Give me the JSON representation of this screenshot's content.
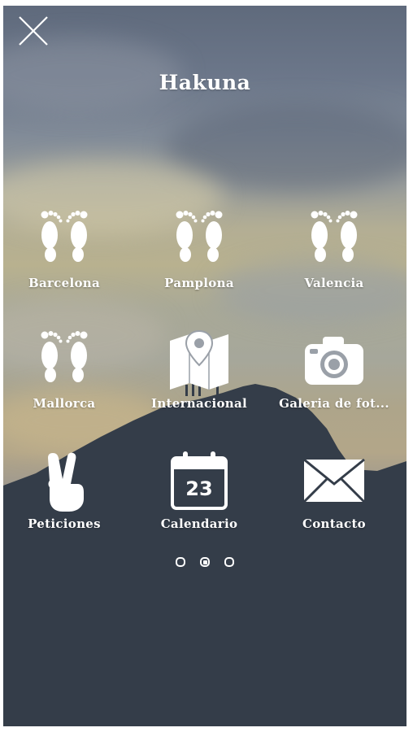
{
  "app": {
    "title": "Hakuna"
  },
  "menu": {
    "items": [
      {
        "label": "Barcelona",
        "icon": "footprints-icon"
      },
      {
        "label": "Pamplona",
        "icon": "footprints-icon"
      },
      {
        "label": "Valencia",
        "icon": "footprints-icon"
      },
      {
        "label": "Mallorca",
        "icon": "footprints-icon"
      },
      {
        "label": "Internacional",
        "icon": "map-pin-icon"
      },
      {
        "label": "Galeria de fot...",
        "icon": "camera-icon"
      },
      {
        "label": "Peticiones",
        "icon": "peace-hand-icon"
      },
      {
        "label": "Calendario",
        "icon": "calendar-icon",
        "calendar_day": "23"
      },
      {
        "label": "Contacto",
        "icon": "envelope-icon"
      }
    ]
  },
  "pagination": {
    "pages": 3,
    "current": 2
  },
  "colors": {
    "mountain": "#343d49",
    "text": "#ffffff",
    "sky_top": "#5f6a7c",
    "sky_glow": "#b8b18f"
  }
}
